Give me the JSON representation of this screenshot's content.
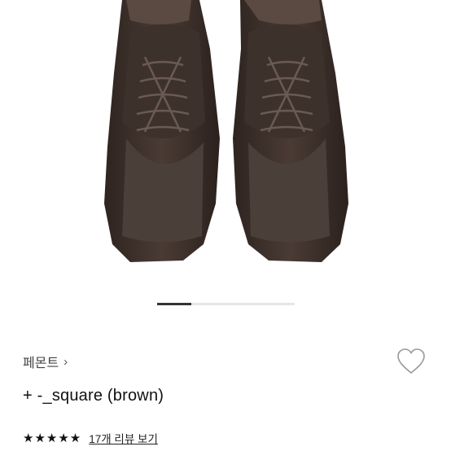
{
  "product": {
    "brand": "페몬트",
    "brand_chevron": "›",
    "name": "+ -_square (brown)",
    "stars": "★★★★★",
    "rating_value": 5,
    "review_link": "17개 리뷰 보기"
  },
  "carousel": {
    "current_position": 0.25
  },
  "icons": {
    "brand_chevron": "chevron-right-icon",
    "wishlist": "heart-outline-icon",
    "rating": "star-icon"
  },
  "colors": {
    "shoe_leather": "#3b2f2a",
    "shoe_suede": "#4a3d37",
    "indicator_active": "#333333",
    "indicator_track": "#e6e6e6"
  }
}
